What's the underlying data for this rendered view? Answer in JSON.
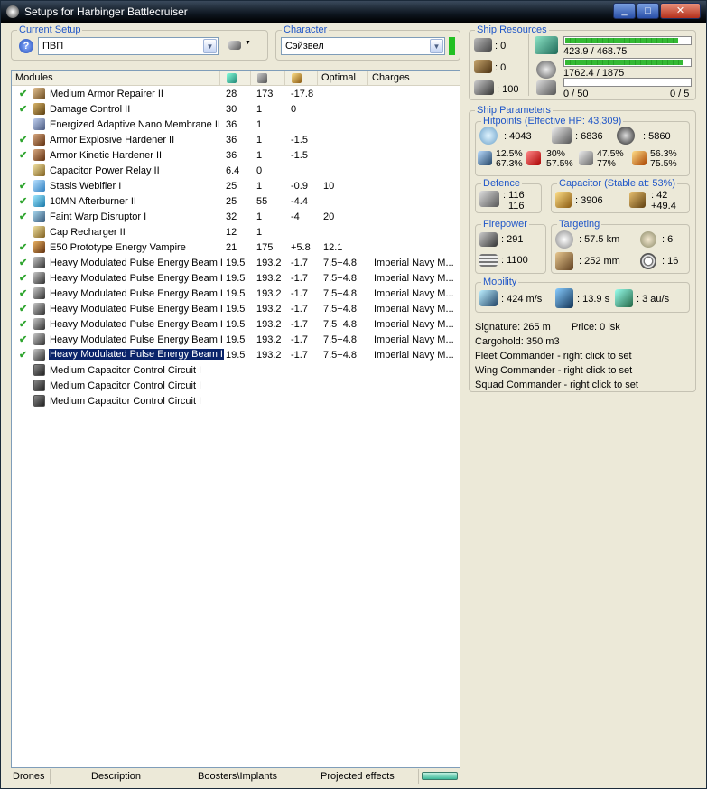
{
  "window": {
    "title": "Setups for Harbinger Battlecruiser",
    "min": "_",
    "max": "□",
    "close": "✕"
  },
  "current_setup": {
    "legend": "Current Setup",
    "value": "ПВП",
    "help": "?"
  },
  "character": {
    "legend": "Character",
    "value": "Сэйзвел",
    "status_color": "#22c022"
  },
  "modules": {
    "headers": {
      "name": "Modules",
      "c4": "Optimal",
      "c5": "Charges"
    },
    "header_icons": [
      "cpu-icon",
      "powergrid-icon",
      "capacitor-icon"
    ],
    "rows": [
      {
        "checked": true,
        "icon": "armor",
        "name": "Medium Armor Repairer II",
        "c1": "28",
        "c2": "173",
        "c3": "-17.8",
        "c4": "",
        "c5": ""
      },
      {
        "checked": true,
        "icon": "dmg",
        "name": "Damage Control II",
        "c1": "30",
        "c2": "1",
        "c3": "0",
        "c4": "",
        "c5": ""
      },
      {
        "checked": false,
        "icon": "nano",
        "name": "Energized Adaptive Nano Membrane II",
        "c1": "36",
        "c2": "1",
        "c3": "",
        "c4": "",
        "c5": ""
      },
      {
        "checked": true,
        "icon": "hard",
        "name": "Armor Explosive Hardener II",
        "c1": "36",
        "c2": "1",
        "c3": "-1.5",
        "c4": "",
        "c5": ""
      },
      {
        "checked": true,
        "icon": "hard",
        "name": "Armor Kinetic Hardener II",
        "c1": "36",
        "c2": "1",
        "c3": "-1.5",
        "c4": "",
        "c5": ""
      },
      {
        "checked": false,
        "icon": "cap",
        "name": "Capacitor Power Relay II",
        "c1": "6.4",
        "c2": "0",
        "c3": "",
        "c4": "",
        "c5": ""
      },
      {
        "checked": true,
        "icon": "web",
        "name": "Stasis Webifier I",
        "c1": "25",
        "c2": "1",
        "c3": "-0.9",
        "c4": "10",
        "c5": ""
      },
      {
        "checked": true,
        "icon": "ab",
        "name": "10MN Afterburner II",
        "c1": "25",
        "c2": "55",
        "c3": "-4.4",
        "c4": "",
        "c5": ""
      },
      {
        "checked": true,
        "icon": "warp",
        "name": "Faint Warp Disruptor I",
        "c1": "32",
        "c2": "1",
        "c3": "-4",
        "c4": "20",
        "c5": ""
      },
      {
        "checked": false,
        "icon": "cap",
        "name": "Cap Recharger II",
        "c1": "12",
        "c2": "1",
        "c3": "",
        "c4": "",
        "c5": ""
      },
      {
        "checked": true,
        "icon": "vamp",
        "name": "E50 Prototype Energy Vampire",
        "c1": "21",
        "c2": "175",
        "c3": "+5.8",
        "c4": "12.1",
        "c5": ""
      },
      {
        "checked": true,
        "icon": "laser",
        "name": "Heavy Modulated Pulse Energy Beam I",
        "c1": "19.5",
        "c2": "193.2",
        "c3": "-1.7",
        "c4": "7.5+4.8",
        "c5": "Imperial Navy M..."
      },
      {
        "checked": true,
        "icon": "laser",
        "name": "Heavy Modulated Pulse Energy Beam I",
        "c1": "19.5",
        "c2": "193.2",
        "c3": "-1.7",
        "c4": "7.5+4.8",
        "c5": "Imperial Navy M..."
      },
      {
        "checked": true,
        "icon": "laser",
        "name": "Heavy Modulated Pulse Energy Beam I",
        "c1": "19.5",
        "c2": "193.2",
        "c3": "-1.7",
        "c4": "7.5+4.8",
        "c5": "Imperial Navy M..."
      },
      {
        "checked": true,
        "icon": "laser",
        "name": "Heavy Modulated Pulse Energy Beam I",
        "c1": "19.5",
        "c2": "193.2",
        "c3": "-1.7",
        "c4": "7.5+4.8",
        "c5": "Imperial Navy M..."
      },
      {
        "checked": true,
        "icon": "laser",
        "name": "Heavy Modulated Pulse Energy Beam I",
        "c1": "19.5",
        "c2": "193.2",
        "c3": "-1.7",
        "c4": "7.5+4.8",
        "c5": "Imperial Navy M..."
      },
      {
        "checked": true,
        "icon": "laser",
        "name": "Heavy Modulated Pulse Energy Beam I",
        "c1": "19.5",
        "c2": "193.2",
        "c3": "-1.7",
        "c4": "7.5+4.8",
        "c5": "Imperial Navy M..."
      },
      {
        "checked": true,
        "icon": "laser",
        "name": "Heavy Modulated Pulse Energy Beam I",
        "c1": "19.5",
        "c2": "193.2",
        "c3": "-1.7",
        "c4": "7.5+4.8",
        "c5": "Imperial Navy M...",
        "selected": true
      },
      {
        "checked": false,
        "icon": "rig",
        "name": "Medium Capacitor Control Circuit I",
        "c1": "",
        "c2": "",
        "c3": "",
        "c4": "",
        "c5": ""
      },
      {
        "checked": false,
        "icon": "rig",
        "name": "Medium Capacitor Control Circuit I",
        "c1": "",
        "c2": "",
        "c3": "",
        "c4": "",
        "c5": ""
      },
      {
        "checked": false,
        "icon": "rig",
        "name": "Medium Capacitor Control Circuit I",
        "c1": "",
        "c2": "",
        "c3": "",
        "c4": "",
        "c5": ""
      }
    ]
  },
  "bottom_tabs": [
    "Drones",
    "Description",
    "Boosters\\Implants",
    "Projected effects"
  ],
  "ship_resources": {
    "legend": "Ship Resources",
    "turrets": ": 0",
    "launchers": ": 0",
    "drone_bay": ": 100",
    "cpu": "423.9 / 468.75",
    "cpu_fraction": 0.904,
    "powergrid": "1762.4 / 1875",
    "powergrid_fraction": 0.94,
    "drone_bw": "0 / 50",
    "drone_count": "0 / 5",
    "drone_fraction": 0
  },
  "ship_parameters": {
    "legend": "Ship Parameters",
    "hitpoints": {
      "legend": "Hitpoints (Effective HP: 43,309)",
      "shield": ": 4043",
      "armor": ": 6836",
      "hull": ": 5860",
      "em_shield": "12.5%",
      "em_armor": "67.3%",
      "th_shield": "30%",
      "th_armor": "57.5%",
      "kin_shield": "47.5%",
      "kin_armor": "77%",
      "exp_shield": "56.3%",
      "exp_armor": "75.5%"
    },
    "defence": {
      "legend": "Defence",
      "v1": ": 116",
      "v2": "116"
    },
    "capacitor": {
      "legend": "Capacitor (Stable at: 53%)",
      "amount": ": 3906",
      "v1": ": 42",
      "v2": "+49.4"
    },
    "firepower": {
      "legend": "Firepower",
      "dps": ": 291",
      "volley": ": 1100"
    },
    "targeting": {
      "legend": "Targeting",
      "range": ": 57.5 km",
      "max_targets": ": 6",
      "scan_res": ": 252 mm",
      "sensor": ": 16"
    },
    "mobility": {
      "legend": "Mobility",
      "speed": ": 424 m/s",
      "align": ": 13.9 s",
      "warp": ": 3 au/s"
    },
    "signature": "Signature: 265 m",
    "price": "Price: 0 isk",
    "cargohold": "Cargohold: 350 m3",
    "fleet": "Fleet Commander - right click to set",
    "wing": "Wing Commander - right click to set",
    "squad": "Squad Commander - right click to set"
  }
}
